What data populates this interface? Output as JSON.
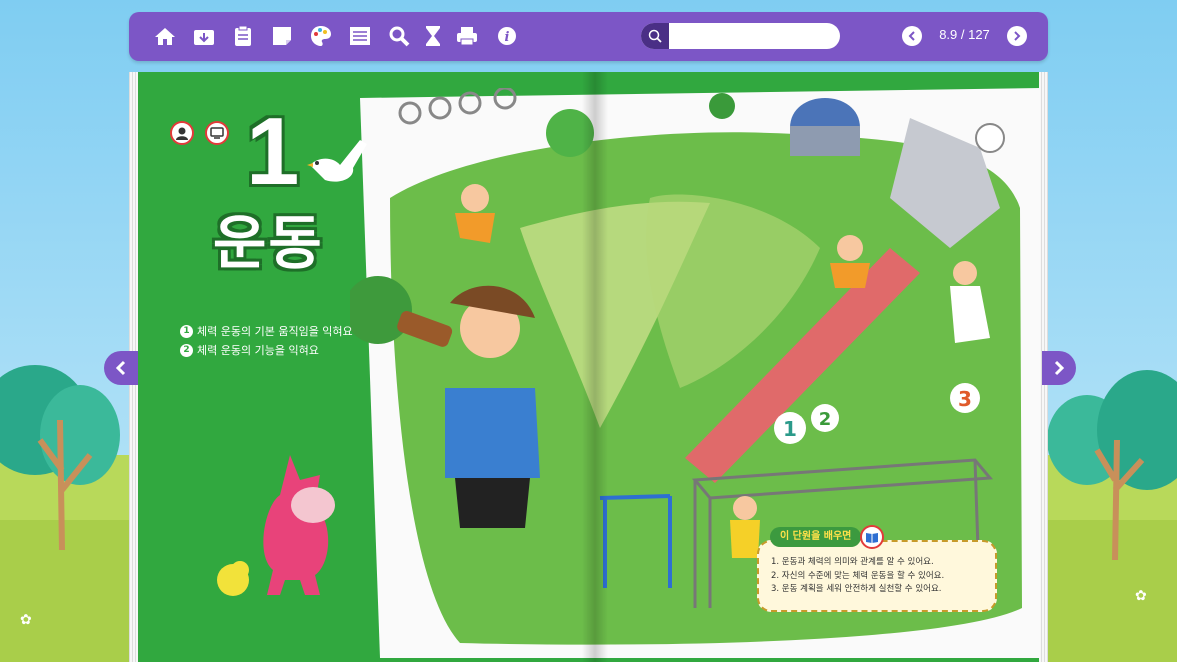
{
  "toolbar": {
    "icons": [
      "home-icon",
      "download-icon",
      "clipboard-icon",
      "memo-icon",
      "palette-icon",
      "contents-icon",
      "zoom-icon",
      "timer-icon",
      "print-icon",
      "info-icon"
    ],
    "search_placeholder": "",
    "page_indicator": "8.9 / 127"
  },
  "chapter": {
    "number": "1",
    "title": "운동",
    "goals": [
      {
        "num": "1",
        "text": "체력 운동의 기본 움직임을 익혀요"
      },
      {
        "num": "2",
        "text": "체력 운동의 기능을 익혀요"
      }
    ]
  },
  "learn": {
    "tag": "이 단원을 배우면",
    "items": [
      "1. 운동과 체력의 의미와 관계를 알 수 있어요.",
      "2. 자신의 수준에 맞는 체력 운동을 할 수 있어요.",
      "3. 운동 계획을 세워 안전하게 실천할 수 있어요."
    ]
  },
  "colors": {
    "toolbar": "#7c56c6",
    "page_green": "#31a83f",
    "accent_red": "#e23a3a"
  }
}
